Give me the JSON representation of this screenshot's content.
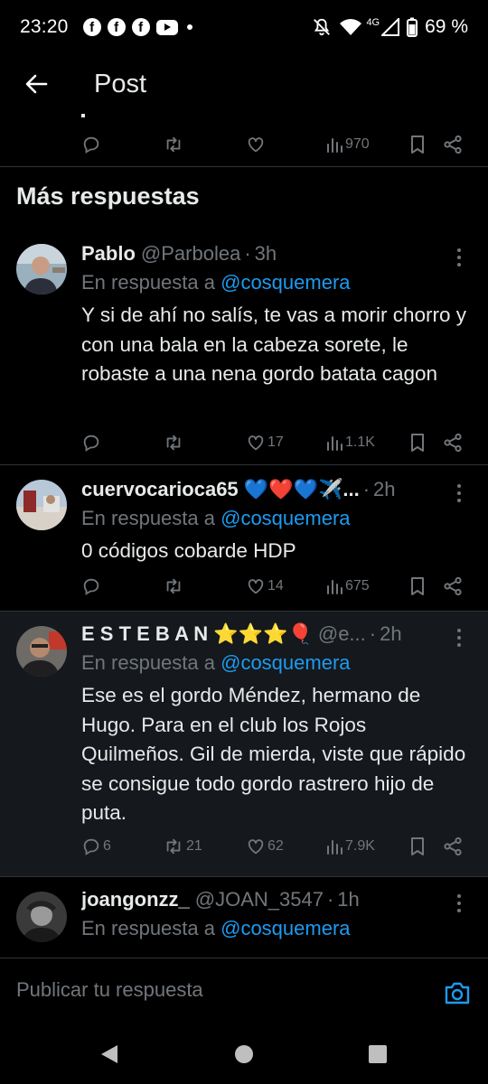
{
  "status_bar": {
    "time": "23:20",
    "app_icons": [
      "facebook-icon",
      "facebook-icon",
      "facebook-icon",
      "youtube-icon"
    ],
    "network": "4G",
    "battery": "69 %"
  },
  "header": {
    "title": "Post"
  },
  "top_post_actions": {
    "views": "970"
  },
  "section_title": "Más respuestas",
  "replies": [
    {
      "name": "Pablo",
      "handle": "@Parbolea",
      "time": "3h",
      "reply_to_label": "En respuesta a",
      "reply_to_mention": "@cosquemera",
      "text": "Y si de ahí no salís, te vas a morir chorro y con una bala en la cabeza sorete, le robaste a una nena gordo batata cagon",
      "replies": "",
      "reposts": "",
      "likes": "17",
      "views": "1.1K"
    },
    {
      "name": "cuervocarioca65 💙❤️💙✈️...",
      "handle": "",
      "time": "2h",
      "reply_to_label": "En respuesta a",
      "reply_to_mention": "@cosquemera",
      "text": "0 códigos cobarde HDP",
      "replies": "",
      "reposts": "",
      "likes": "14",
      "views": "675"
    },
    {
      "name": "E S T E B A N ⭐⭐⭐🎈",
      "handle": "@e...",
      "time": "2h",
      "reply_to_label": "En respuesta a",
      "reply_to_mention": "@cosquemera",
      "text": "Ese es el gordo Méndez, hermano de Hugo. Para en el club los Rojos Quilmeños. Gil de mierda, viste que rápido se consigue todo gordo rastrero hijo de puta.",
      "replies": "6",
      "reposts": "21",
      "likes": "62",
      "views": "7.9K"
    },
    {
      "name": "joangonzz_",
      "handle": "@JOAN_3547",
      "time": "1h",
      "reply_to_label": "En respuesta a",
      "reply_to_mention": "@cosquemera",
      "text": ""
    }
  ],
  "composer": {
    "placeholder": "Publicar tu respuesta"
  },
  "colors": {
    "background": "#000000",
    "highlight_row": "#15181c",
    "text_primary": "#e7e9ea",
    "text_secondary": "#71767b",
    "accent": "#1d9bf0",
    "divider": "#2f3336"
  }
}
